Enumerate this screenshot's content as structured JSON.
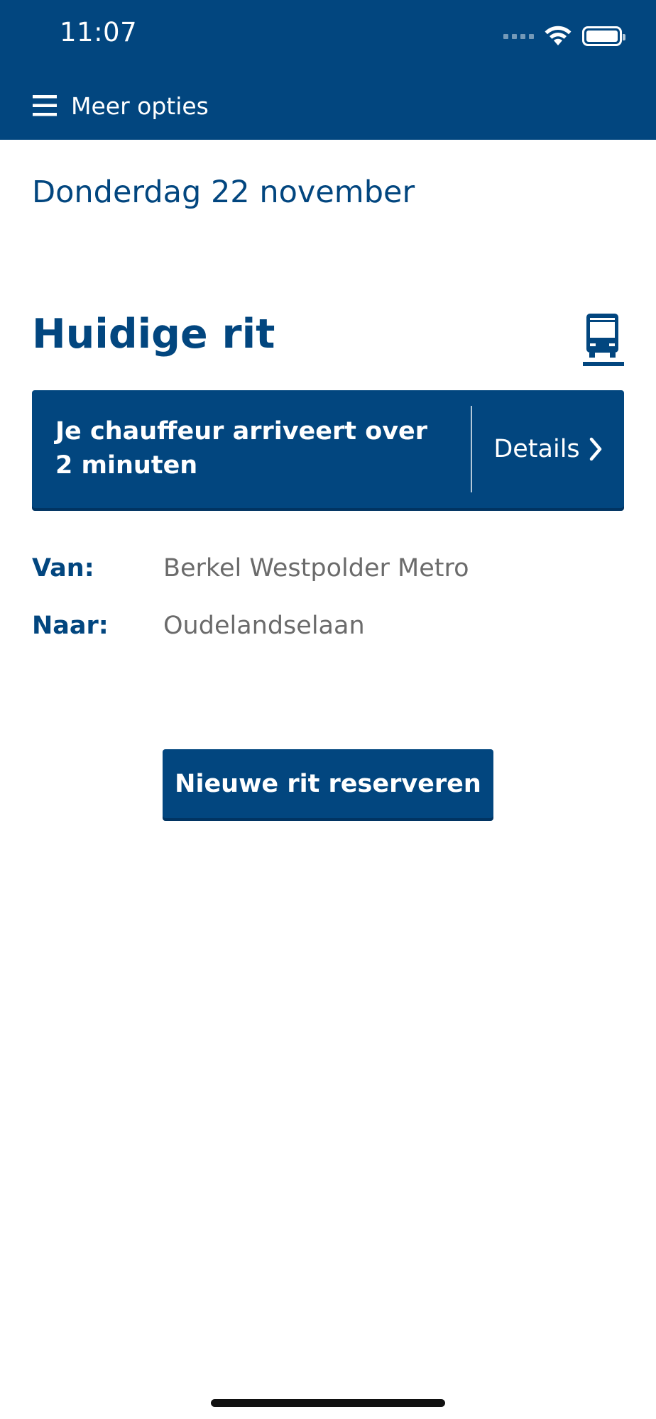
{
  "status_bar": {
    "time": "11:07",
    "icons": [
      "signal-icon",
      "wifi-icon",
      "battery-icon"
    ]
  },
  "header": {
    "menu_icon": "hamburger-icon",
    "menu_label": "Meer opties"
  },
  "date": "Donderdag 22 november",
  "current_ride": {
    "title": "Huidige rit",
    "vehicle_icon": "bus-icon",
    "banner": {
      "message": "Je chauffeur arriveert over 2 minuten",
      "details_label": "Details",
      "details_icon": "chevron-right-icon"
    },
    "route": {
      "from_label": "Van:",
      "from_value": "Berkel Westpolder Metro",
      "to_label": "Naar:",
      "to_value": "Oudelandselaan"
    }
  },
  "actions": {
    "new_ride_label": "Nieuwe rit reserveren"
  },
  "colors": {
    "primary": "#02467f",
    "text_muted": "#6b6b6b",
    "background": "#ffffff"
  }
}
